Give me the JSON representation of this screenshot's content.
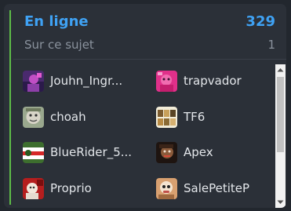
{
  "online_widget": {
    "title": "En ligne",
    "total_count": "329",
    "topic_label": "Sur ce sujet",
    "topic_count": "1",
    "accent_color": "#3fa2f4",
    "users": [
      {
        "name": "Jouhn_Ingr...",
        "avatar_icon": "avatar-purple-icon"
      },
      {
        "name": "trapvador",
        "avatar_icon": "avatar-pink-icon"
      },
      {
        "name": "choah",
        "avatar_icon": "avatar-face-icon"
      },
      {
        "name": "TF6",
        "avatar_icon": "avatar-collage-icon"
      },
      {
        "name": "BlueRider_5...",
        "avatar_icon": "avatar-flag-icon"
      },
      {
        "name": "Apex",
        "avatar_icon": "avatar-dark-face-icon"
      },
      {
        "name": "Proprio",
        "avatar_icon": "avatar-red-icon"
      },
      {
        "name": "SalePetiteP",
        "avatar_icon": "avatar-cartoon-icon"
      }
    ]
  }
}
